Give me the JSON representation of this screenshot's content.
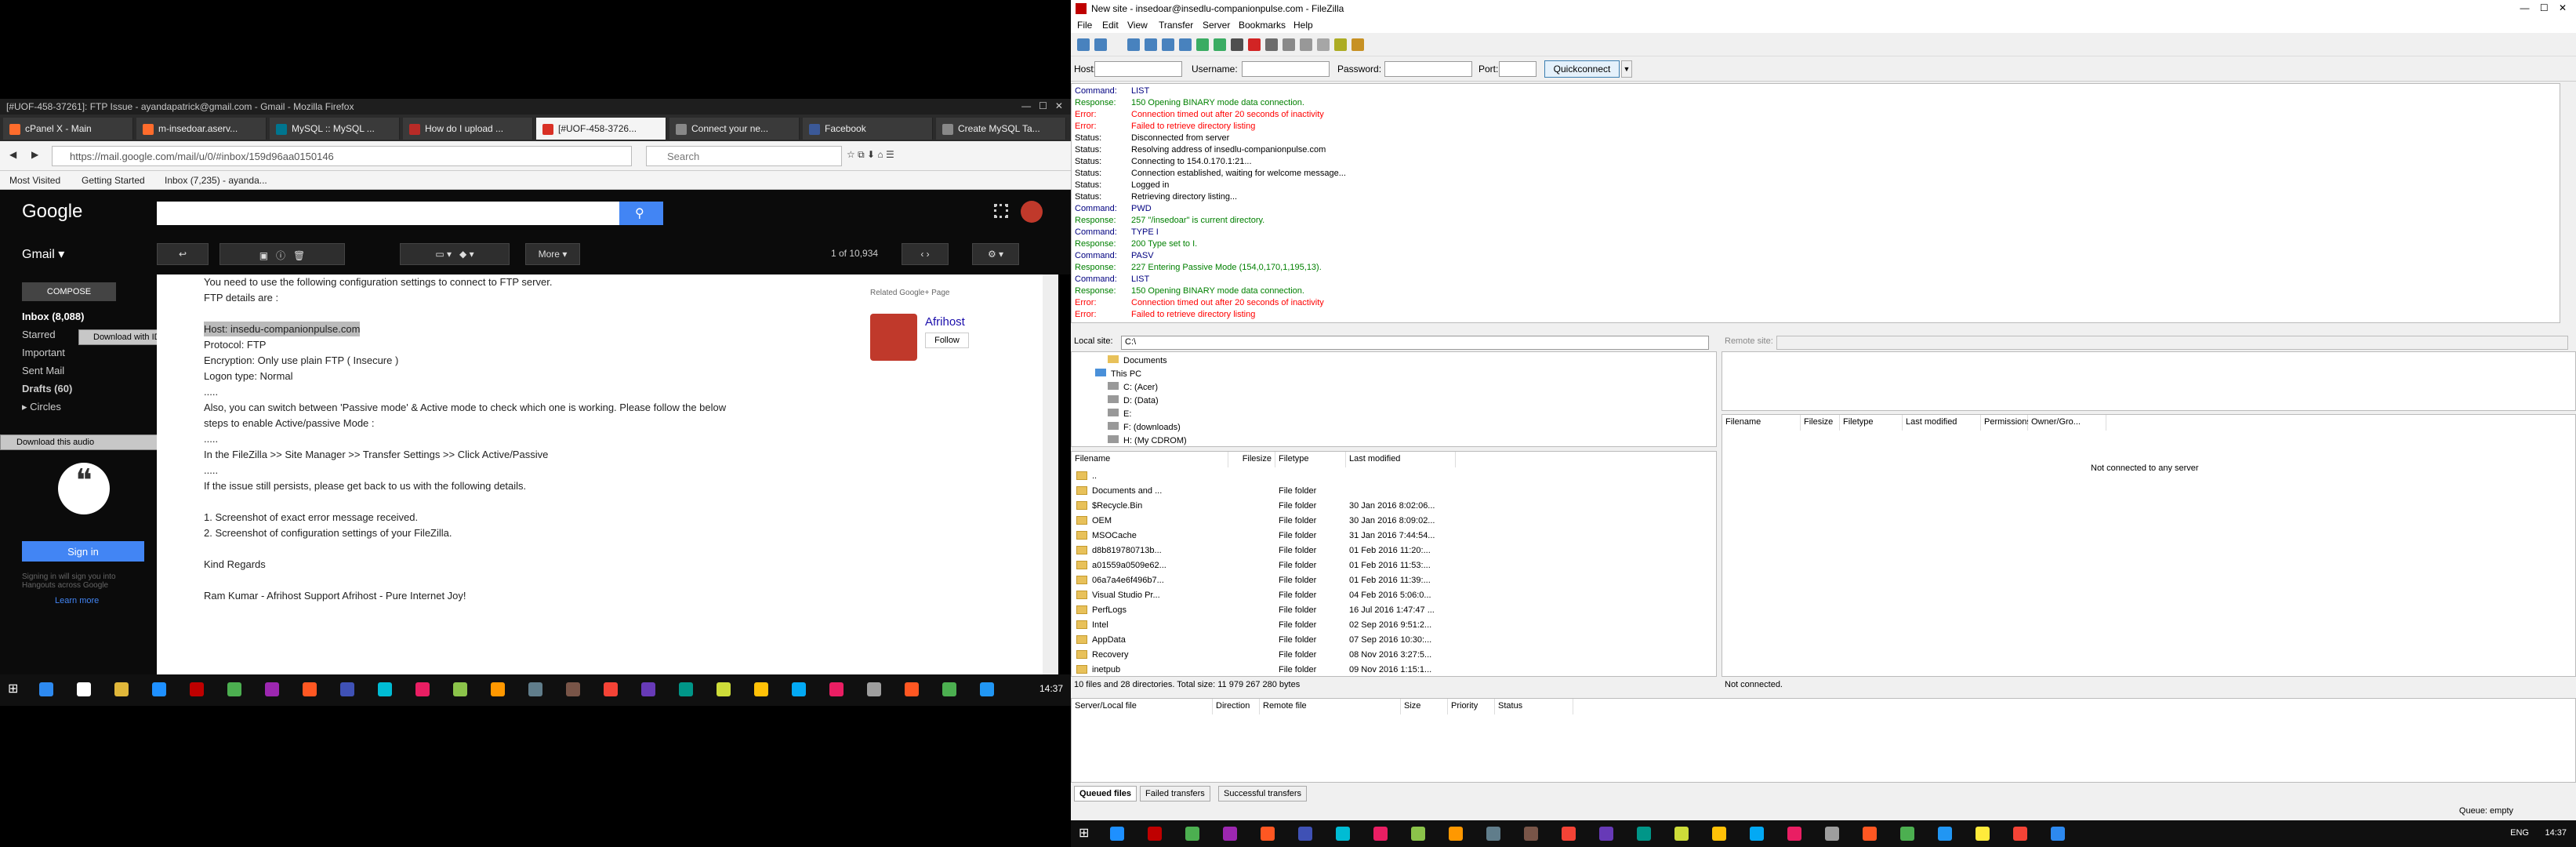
{
  "firefox": {
    "window_title": "[#UOF-458-37261]: FTP Issue - ayandapatrick@gmail.com - Gmail - Mozilla Firefox",
    "tabs": [
      {
        "label": "cPanel X - Main",
        "color": "#ff6c2c"
      },
      {
        "label": "m-insedoar.aserv...",
        "color": "#ff6c2c"
      },
      {
        "label": "MySQL :: MySQL ...",
        "color": "#00758f"
      },
      {
        "label": "How do I upload ...",
        "color": "#b92b27"
      },
      {
        "label": "[#UOF-458-3726...",
        "color": "#d93025"
      },
      {
        "label": "Connect your ne...",
        "color": "#888888"
      },
      {
        "label": "Facebook",
        "color": "#3b5998"
      },
      {
        "label": "Create MySQL Ta...",
        "color": "#888888"
      }
    ],
    "url": "https://mail.google.com/mail/u/0/#inbox/159d96aa0150146",
    "search_placeholder": "Search",
    "bookmarks": [
      "Most Visited",
      "Getting Started",
      "Inbox (7,235) - ayanda..."
    ]
  },
  "gmail": {
    "logo": "Google",
    "label": "Gmail ▾",
    "pager": "1 of 10,934",
    "more": "More ▾",
    "compose": "COMPOSE",
    "nav": [
      "Inbox (8,088)",
      "Starred",
      "Important",
      "Sent Mail",
      "Drafts (60)",
      "▸ Circles"
    ],
    "idm_download": "Download with IDM",
    "idm_audio": "Download this audio",
    "signin": "Sign in",
    "signin_note": "Signing in will sign you into Hangouts across Google",
    "learn_more": "Learn more",
    "body": [
      "You need to use the following configuration settings to connect to FTP server.",
      "FTP details are :",
      "Host: insedu-companionpulse.com",
      "Protocol: FTP",
      "Encryption: Only use plain FTP ( Insecure )",
      "Logon type: Normal",
      ".....",
      "Also, you can switch between 'Passive mode' & Active mode to check which one is working. Please follow the below",
      "steps to enable Active/passive Mode :",
      ".....",
      "In the FileZilla >> Site Manager >> Transfer Settings >> Click Active/Passive",
      ".....",
      "If the issue still persists, please get back to us with the following details.",
      "1. Screenshot of exact error message received.",
      "2. Screenshot of configuration settings of your FileZilla.",
      "Kind Regards",
      "Ram Kumar - Afrihost Support Afrihost - Pure Internet Joy!"
    ],
    "related": "Related Google+ Page",
    "afrihost": "Afrihost",
    "follow": "Follow"
  },
  "clock_left": "14:37",
  "filezilla": {
    "title": "New site - insedoar@insedlu-companionpulse.com - FileZilla",
    "menu": [
      "File",
      "Edit",
      "View",
      "Transfer",
      "Server",
      "Bookmarks",
      "Help"
    ],
    "host_label": "Host:",
    "user_label": "Username:",
    "pass_label": "Password:",
    "port_label": "Port:",
    "quickconnect": "Quickconnect",
    "log": [
      {
        "k": "Command:",
        "t": "LIST",
        "c": "c-cmd"
      },
      {
        "k": "Response:",
        "t": "150 Opening BINARY mode data connection.",
        "c": "c-resp"
      },
      {
        "k": "Error:",
        "t": "Connection timed out after 20 seconds of inactivity",
        "c": "c-err"
      },
      {
        "k": "Error:",
        "t": "Failed to retrieve directory listing",
        "c": "c-err"
      },
      {
        "k": "Status:",
        "t": "Disconnected from server",
        "c": "c-status"
      },
      {
        "k": "Status:",
        "t": "Resolving address of insedlu-companionpulse.com",
        "c": "c-status"
      },
      {
        "k": "Status:",
        "t": "Connecting to 154.0.170.1:21...",
        "c": "c-status"
      },
      {
        "k": "Status:",
        "t": "Connection established, waiting for welcome message...",
        "c": "c-status"
      },
      {
        "k": "Status:",
        "t": "Logged in",
        "c": "c-status"
      },
      {
        "k": "Status:",
        "t": "Retrieving directory listing...",
        "c": "c-status"
      },
      {
        "k": "Command:",
        "t": "PWD",
        "c": "c-cmd"
      },
      {
        "k": "Response:",
        "t": "257 \"/insedoar\" is current directory.",
        "c": "c-resp"
      },
      {
        "k": "Command:",
        "t": "TYPE I",
        "c": "c-cmd"
      },
      {
        "k": "Response:",
        "t": "200 Type set to I.",
        "c": "c-resp"
      },
      {
        "k": "Command:",
        "t": "PASV",
        "c": "c-cmd"
      },
      {
        "k": "Response:",
        "t": "227 Entering Passive Mode (154,0,170,1,195,13).",
        "c": "c-resp"
      },
      {
        "k": "Command:",
        "t": "LIST",
        "c": "c-cmd"
      },
      {
        "k": "Response:",
        "t": "150 Opening BINARY mode data connection.",
        "c": "c-resp"
      },
      {
        "k": "Error:",
        "t": "Connection timed out after 20 seconds of inactivity",
        "c": "c-err"
      },
      {
        "k": "Error:",
        "t": "Failed to retrieve directory listing",
        "c": "c-err"
      }
    ],
    "local_site_label": "Local site:",
    "local_site_value": "C:\\",
    "remote_site_label": "Remote site:",
    "tree": [
      "Documents",
      "This PC",
      "C: (Acer)",
      "D: (Data)",
      "E:",
      "F: (downloads)",
      "H: (My CDROM)"
    ],
    "local_cols": [
      "Filename",
      "Filesize",
      "Filetype",
      "Last modified"
    ],
    "local_files": [
      {
        "name": "..",
        "type": "",
        "date": ""
      },
      {
        "name": "Documents and ...",
        "type": "File folder",
        "date": ""
      },
      {
        "name": "$Recycle.Bin",
        "type": "File folder",
        "date": "30 Jan 2016 8:02:06..."
      },
      {
        "name": "OEM",
        "type": "File folder",
        "date": "30 Jan 2016 8:09:02..."
      },
      {
        "name": "MSOCache",
        "type": "File folder",
        "date": "31 Jan 2016 7:44:54..."
      },
      {
        "name": "d8b819780713b...",
        "type": "File folder",
        "date": "01 Feb 2016 11:20:..."
      },
      {
        "name": "a01559a0509e62...",
        "type": "File folder",
        "date": "01 Feb 2016 11:53:..."
      },
      {
        "name": "06a7a4e6f496b7...",
        "type": "File folder",
        "date": "01 Feb 2016 11:39:..."
      },
      {
        "name": "Visual Studio Pr...",
        "type": "File folder",
        "date": "04 Feb 2016 5:06:0..."
      },
      {
        "name": "PerfLogs",
        "type": "File folder",
        "date": "16 Jul 2016 1:47:47 ..."
      },
      {
        "name": "Intel",
        "type": "File folder",
        "date": "02 Sep 2016 9:51:2..."
      },
      {
        "name": "AppData",
        "type": "File folder",
        "date": "07 Sep 2016 10:30:..."
      },
      {
        "name": "Recovery",
        "type": "File folder",
        "date": "08 Nov 2016 3:27:5..."
      },
      {
        "name": "inetpub",
        "type": "File folder",
        "date": "09 Nov 2016 1:15:1..."
      }
    ],
    "local_status": "10 files and 28 directories. Total size: 11 979 267 280 bytes",
    "remote_cols": [
      "Filename",
      "Filesize",
      "Filetype",
      "Last modified",
      "Permissions",
      "Owner/Gro..."
    ],
    "remote_empty": "Not connected to any server",
    "remote_status": "Not connected.",
    "queue_cols": [
      "Server/Local file",
      "Direction",
      "Remote file",
      "Size",
      "Priority",
      "Status"
    ],
    "queue_tabs": [
      "Queued files",
      "Failed transfers",
      "Successful transfers"
    ],
    "queue_status": "Queue: empty",
    "clock": "14:37",
    "lang": "ENG"
  }
}
